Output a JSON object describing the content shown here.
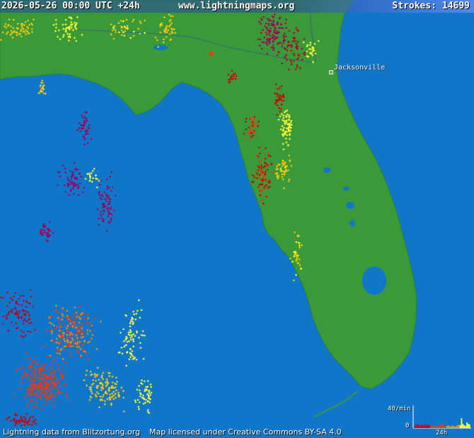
{
  "header": {
    "timestamp": "2026-05-26 00:00 UTC +24h",
    "site": "www.lightningmaps.org",
    "strokes": "Strokes: 14699"
  },
  "map": {
    "ocean_color": "#0f76c9",
    "land_color": "#3a9a3a",
    "lake_color": "#0f76c9",
    "city_label": "Jacksonville"
  },
  "legend": {
    "max_rate": "40/min",
    "zero": "0",
    "range": "24h"
  },
  "footer": {
    "data_credit": "Lightning data from Blitzortung.org",
    "map_license": "Map licensed under Creative Commons BY-SA 4.0"
  },
  "strike_colors": [
    "#ffff33",
    "#ffcc00",
    "#ff8c00",
    "#ff3300",
    "#cc0000",
    "#aa0044",
    "#990066"
  ]
}
